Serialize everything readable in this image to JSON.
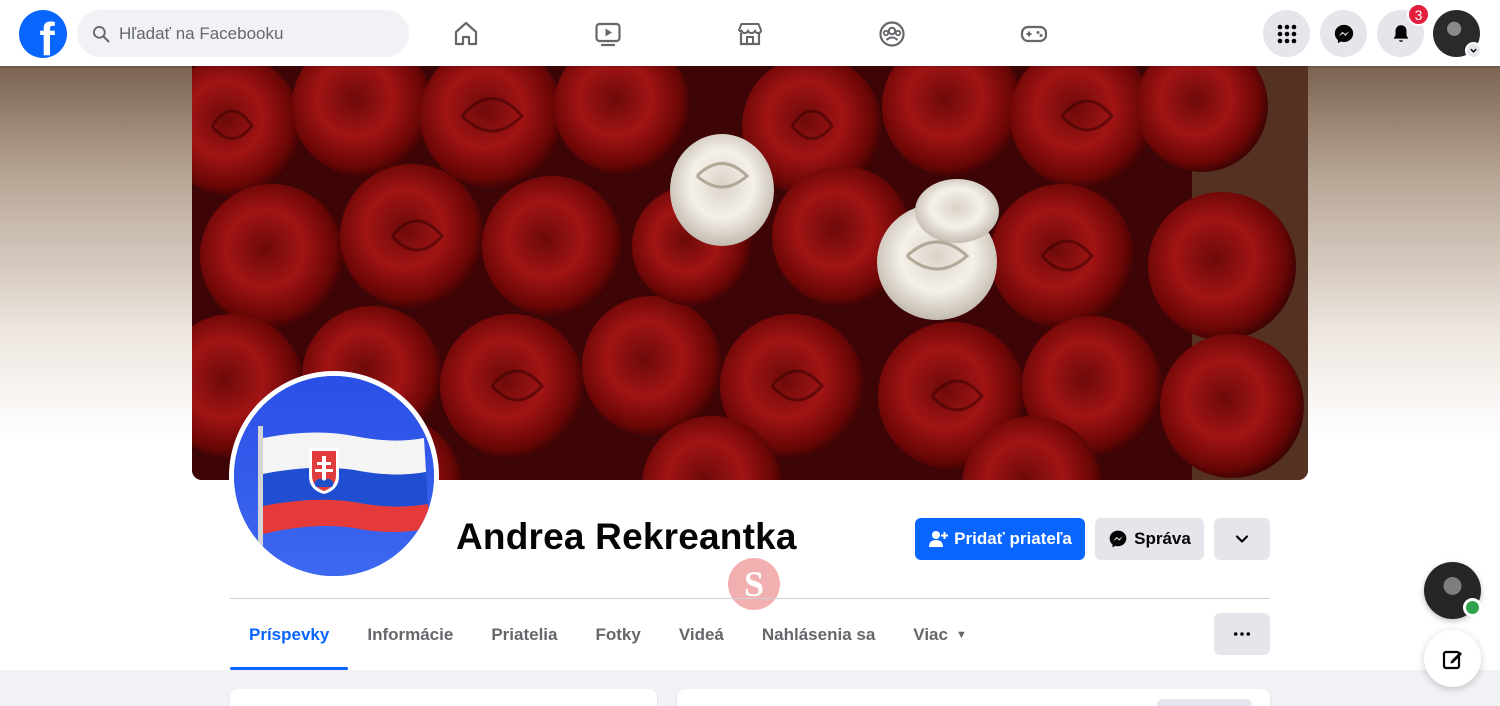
{
  "header": {
    "logo_letter": "f",
    "search": {
      "placeholder": "Hľadať na Facebooku"
    },
    "nav_icons": [
      "home-icon",
      "watch-icon",
      "marketplace-icon",
      "groups-icon",
      "gaming-icon"
    ],
    "right_icons": [
      "menu-grid-icon",
      "messenger-icon",
      "notifications-icon"
    ],
    "notification_count": "3"
  },
  "profile": {
    "name": "Andrea Rekreantka",
    "add_friend_label": "Pridať priateľa",
    "message_label": "Správa"
  },
  "tabs": [
    {
      "label": "Príspevky",
      "active": true
    },
    {
      "label": "Informácie"
    },
    {
      "label": "Priatelia"
    },
    {
      "label": "Fotky"
    },
    {
      "label": "Videá"
    },
    {
      "label": "Nahlásenia sa"
    },
    {
      "label": "Viac",
      "dropdown": true
    }
  ],
  "colors": {
    "brand": "#0866ff",
    "badge": "#e41e3f",
    "online": "#31a24c"
  }
}
